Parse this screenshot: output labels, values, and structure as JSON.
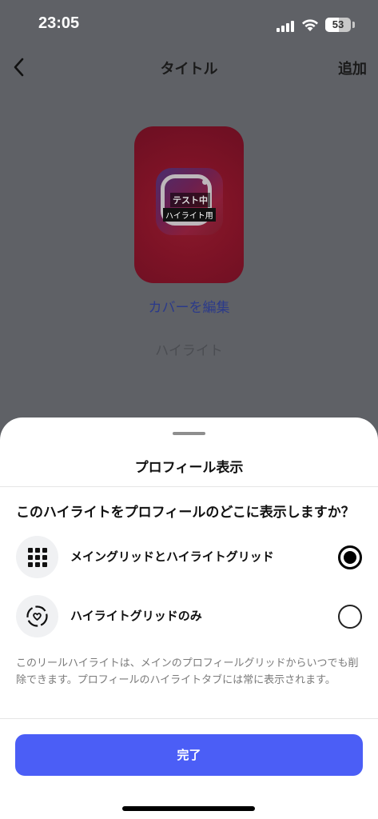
{
  "status": {
    "time": "23:05",
    "battery": "53",
    "battery_level": 0.53
  },
  "header": {
    "title": "タイトル",
    "add_label": "追加"
  },
  "cover": {
    "tag_line1": "テスト中",
    "tag_line2": "ハイライト用",
    "edit_label": "カバーを編集"
  },
  "highlight_name_placeholder": "ハイライト",
  "sheet": {
    "title": "プロフィール表示",
    "question": "このハイライトをプロフィールのどこに表示しますか？",
    "options": [
      {
        "label": "メイングリッドとハイライトグリッド",
        "icon": "grid-icon",
        "selected": true
      },
      {
        "label": "ハイライトグリッドのみ",
        "icon": "highlight-heart-icon",
        "selected": false
      }
    ],
    "note": "このリールハイライトは、メインのプロフィールグリッドからいつでも削除できます。プロフィールのハイライトタブには常に表示されます。",
    "done_label": "完了"
  },
  "colors": {
    "overlay_bg": "#5f6166",
    "accent_button": "#4b5ef6",
    "link": "#2b3a8a",
    "cover_red": "#7e1326"
  }
}
